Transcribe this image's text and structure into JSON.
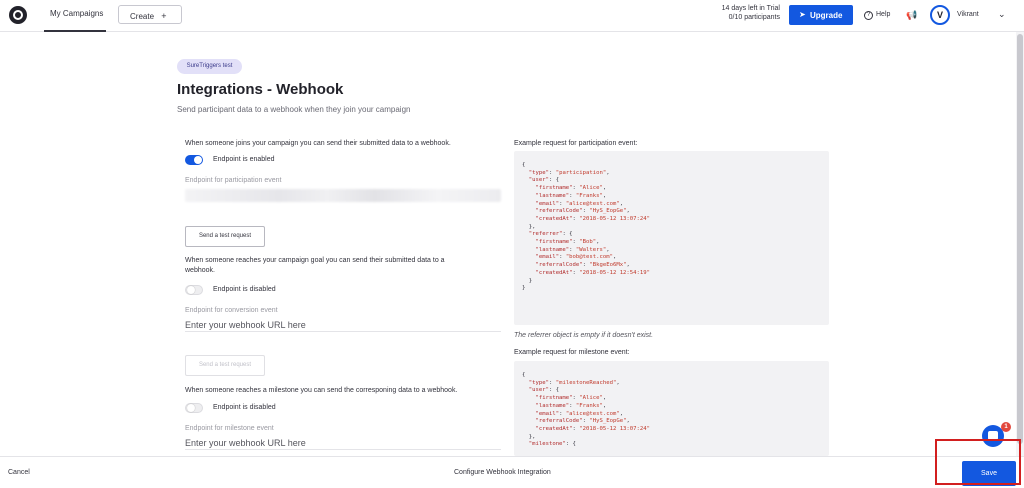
{
  "header": {
    "nav_my_campaigns": "My Campaigns",
    "create_label": "Create",
    "create_icon": "+",
    "trial_line1": "14 days left in Trial",
    "trial_line2": "0/10 participants",
    "upgrade_label": "Upgrade",
    "help_label": "Help",
    "avatar_initial": "V",
    "username": "Vikrant"
  },
  "page": {
    "badge": "SureTriggers test",
    "title": "Integrations - Webhook",
    "subtitle": "Send participant data to a webhook when they join your campaign"
  },
  "participation": {
    "description": "When someone joins your campaign you can send their submitted data to a webhook.",
    "toggle_label": "Endpoint is enabled",
    "enabled": true,
    "endpoint_label": "Endpoint for participation event",
    "test_button": "Send a test request"
  },
  "conversion": {
    "description_line1": "When someone reaches your campaign goal you can send their submitted data to a",
    "description_line2": "webhook.",
    "toggle_label": "Endpoint is disabled",
    "enabled": false,
    "endpoint_label": "Endpoint for conversion event",
    "placeholder": "Enter your webhook URL here",
    "test_button": "Send a test request"
  },
  "milestone": {
    "description": "When someone reaches a milestone you can send the corresponing data to a webhook.",
    "toggle_label": "Endpoint is disabled",
    "enabled": false,
    "endpoint_label": "Endpoint for milestone event",
    "placeholder": "Enter your webhook URL here"
  },
  "examples": {
    "participation_heading": "Example request for participation event:",
    "participation_code": "{\n  \"type\": \"participation\",\n  \"user\": {\n    \"firstname\": \"Alice\",\n    \"lastname\": \"Franks\",\n    \"email\": \"alice@test.com\",\n    \"referralCode\": \"HyS_EopGe\",\n    \"createdAt\": \"2018-05-12 13:07:24\"\n  },\n  \"referrer\": {\n    \"firstname\": \"Bob\",\n    \"lastname\": \"Walters\",\n    \"email\": \"bob@test.com\",\n    \"referralCode\": \"BkgeEo6Mx\",\n    \"createdAt\": \"2018-05-12 12:54:19\"\n  }\n}",
    "referrer_note": "The referrer object is empty if it doesn't exist.",
    "milestone_heading": "Example request for milestone event:",
    "milestone_code": "{\n  \"type\": \"milestoneReached\",\n  \"user\": {\n    \"firstname\": \"Alice\",\n    \"lastname\": \"Franks\",\n    \"email\": \"alice@test.com\",\n    \"referralCode\": \"HyS_EopGe\",\n    \"createdAt\": \"2018-05-12 13:07:24\"\n  },\n  \"milestone\": {"
  },
  "footer": {
    "cancel": "Cancel",
    "title": "Configure Webhook Integration",
    "save": "Save"
  },
  "chat": {
    "badge_count": "1"
  },
  "colors": {
    "accent": "#1358e0",
    "highlight": "#d21f1f",
    "code_bg": "#f2f2f4"
  },
  "icons": {
    "logo": "app-logo-icon",
    "upgrade": "rocket-icon",
    "help": "question-circle-icon",
    "announcements": "megaphone-icon",
    "account_menu": "chevron-down-icon",
    "chat": "chat-bubble-icon"
  }
}
